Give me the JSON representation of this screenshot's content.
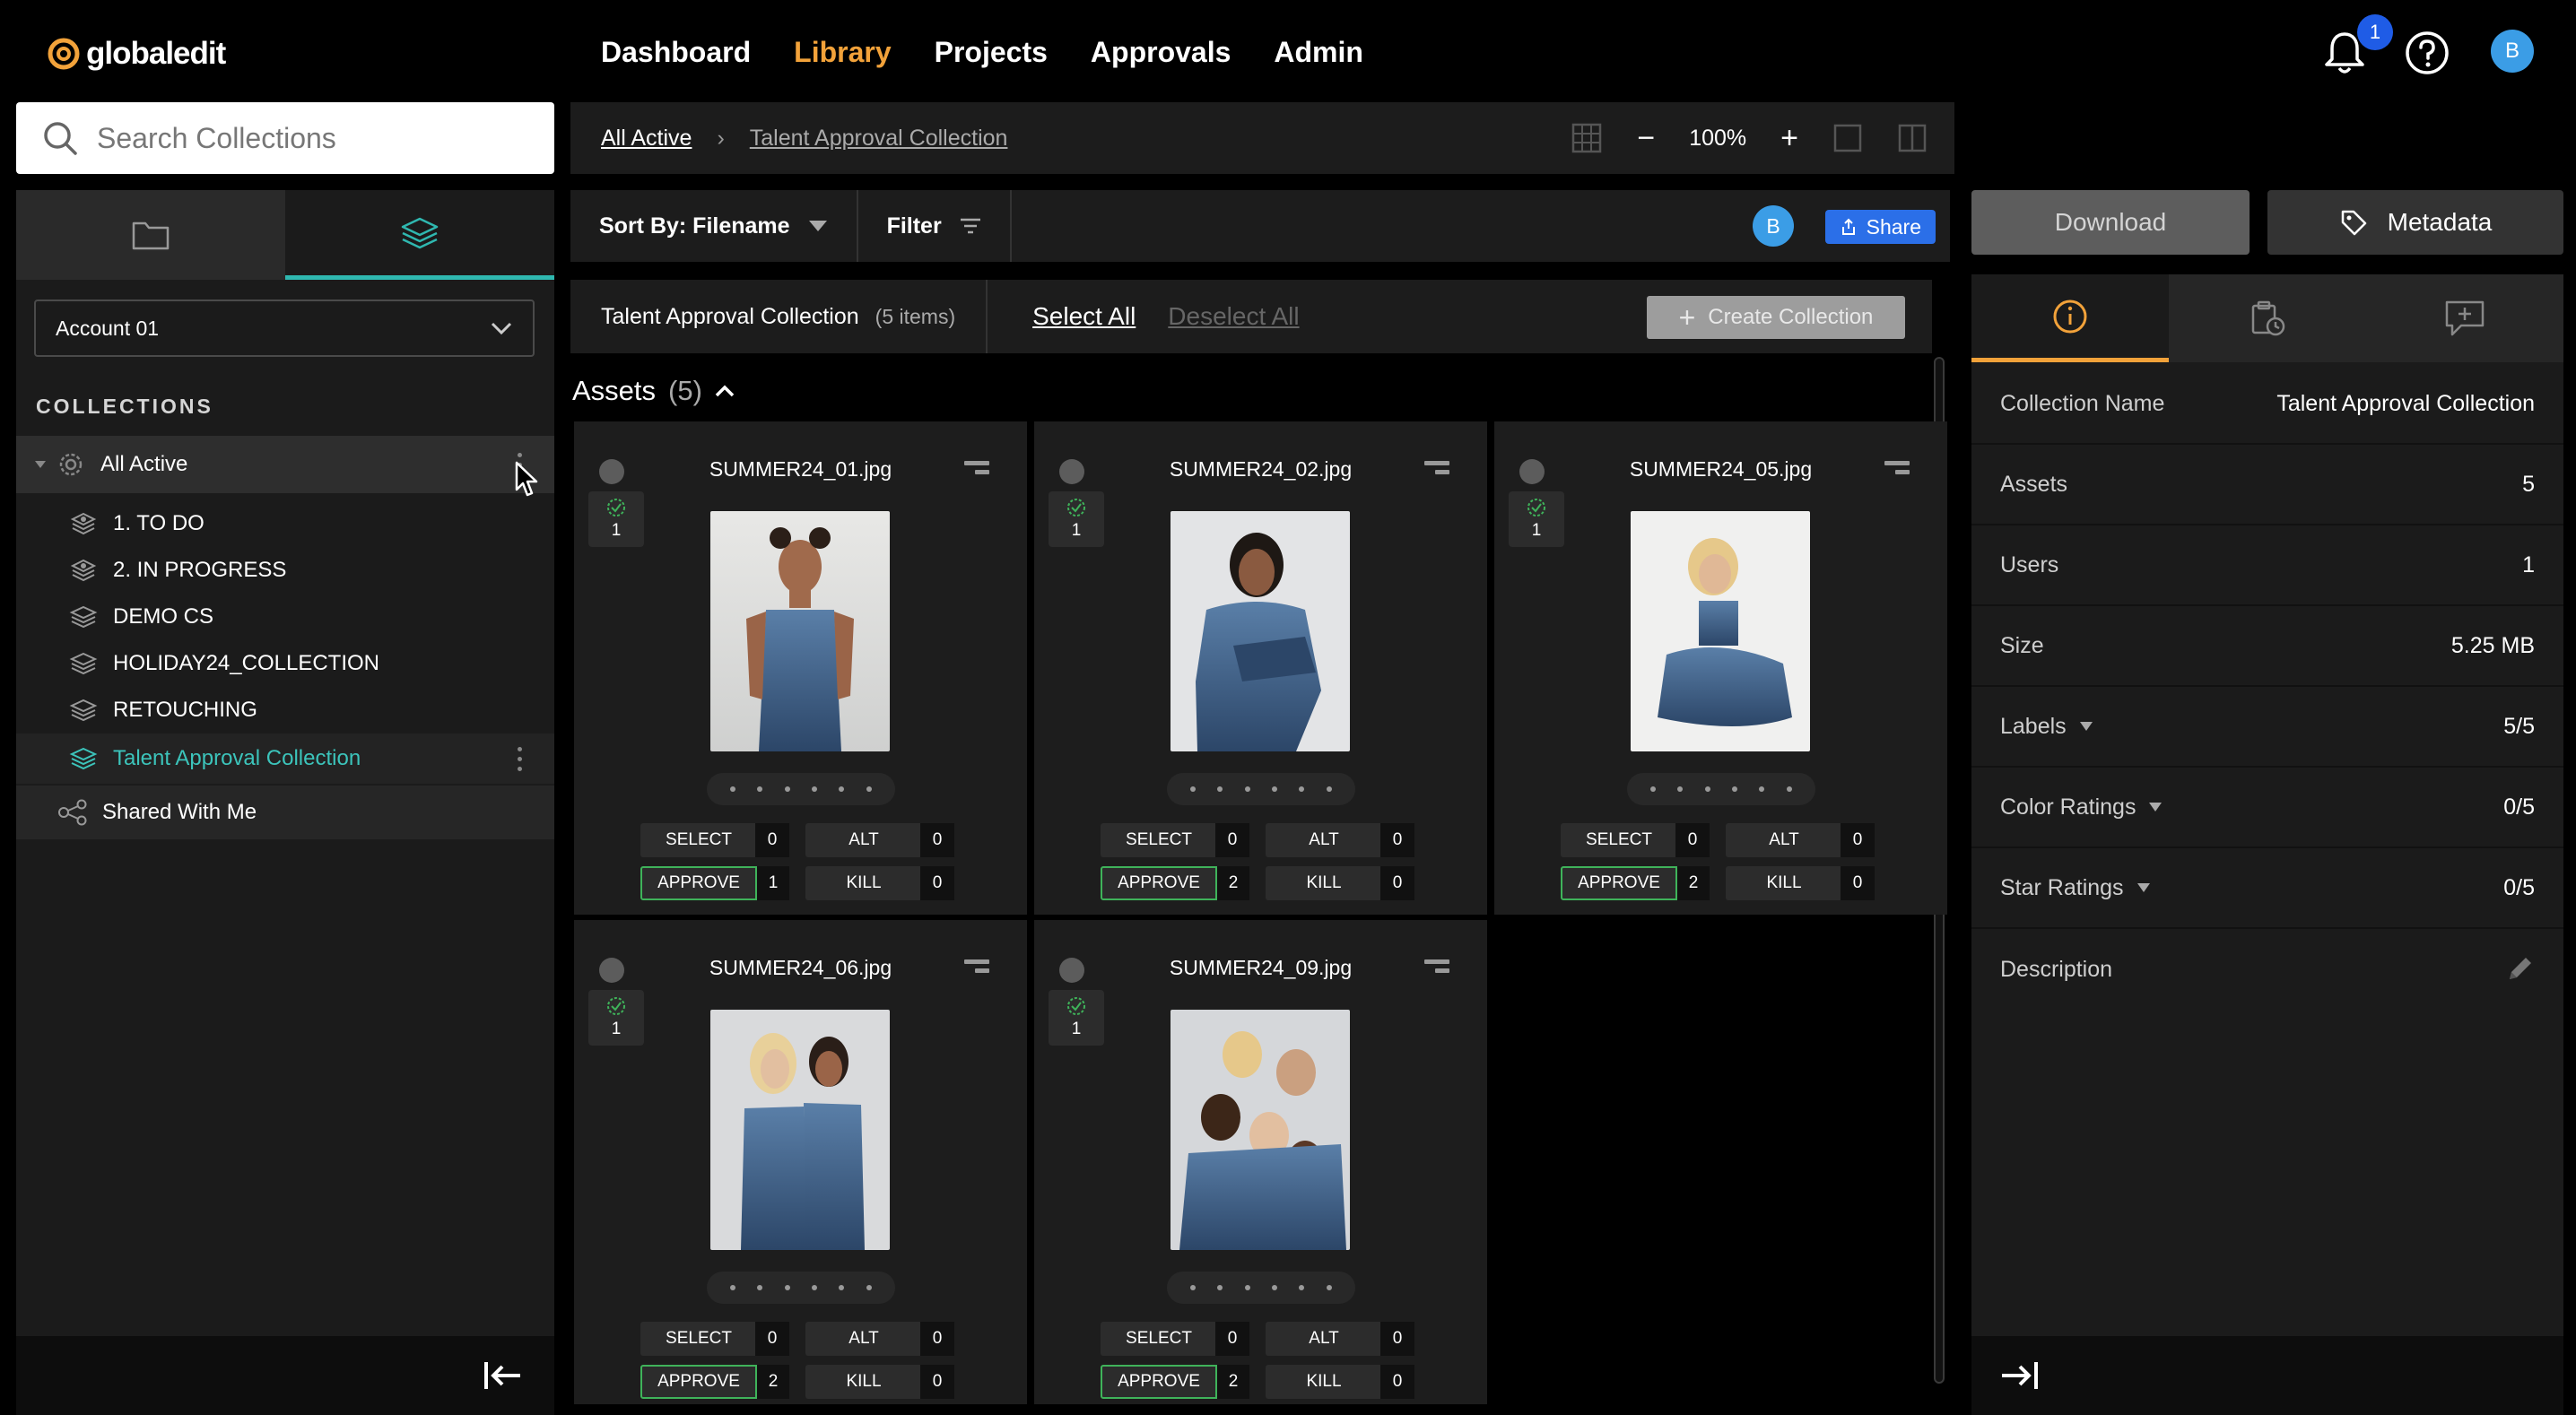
{
  "brand": {
    "name": "globaledit"
  },
  "nav": {
    "items": [
      "Dashboard",
      "Library",
      "Projects",
      "Approvals",
      "Admin"
    ],
    "active": "Library"
  },
  "header": {
    "notification_count": "1",
    "user_initial": "B"
  },
  "search": {
    "placeholder": "Search Collections"
  },
  "sidebar": {
    "account": "Account 01",
    "collections_header": "COLLECTIONS",
    "all_active": "All Active",
    "items": [
      "1. TO DO",
      "2. IN PROGRESS",
      "DEMO CS",
      "HOLIDAY24_COLLECTION",
      "RETOUCHING",
      "Talent Approval Collection"
    ],
    "shared": "Shared With Me"
  },
  "breadcrumb": {
    "root": "All Active",
    "current": "Talent Approval Collection"
  },
  "zoom": {
    "level": "100%"
  },
  "toolbar": {
    "sort_label": "Sort By: Filename",
    "filter_label": "Filter",
    "share_label": "Share",
    "user_initial": "B"
  },
  "collection_bar": {
    "title": "Talent Approval Collection",
    "count": "(5 items)",
    "select_all": "Select All",
    "deselect_all": "Deselect All",
    "create_label": "Create Collection"
  },
  "assets": {
    "heading": "Assets",
    "count": "(5)"
  },
  "cards": [
    {
      "filename": "SUMMER24_01.jpg",
      "version": "1",
      "select": "0",
      "alt": "0",
      "approve": "1",
      "kill": "0"
    },
    {
      "filename": "SUMMER24_02.jpg",
      "version": "1",
      "select": "0",
      "alt": "0",
      "approve": "2",
      "kill": "0"
    },
    {
      "filename": "SUMMER24_05.jpg",
      "version": "1",
      "select": "0",
      "alt": "0",
      "approve": "2",
      "kill": "0"
    },
    {
      "filename": "SUMMER24_06.jpg",
      "version": "1",
      "select": "0",
      "alt": "0",
      "approve": "2",
      "kill": "0"
    },
    {
      "filename": "SUMMER24_09.jpg",
      "version": "1",
      "select": "0",
      "alt": "0",
      "approve": "2",
      "kill": "0"
    }
  ],
  "labels": {
    "select": "SELECT",
    "alt": "ALT",
    "approve": "APPROVE",
    "kill": "KILL"
  },
  "actions": {
    "download": "Download",
    "metadata": "Metadata"
  },
  "details": {
    "collection_name_label": "Collection Name",
    "collection_name": "Talent Approval Collection",
    "assets_label": "Assets",
    "assets": "5",
    "users_label": "Users",
    "users": "1",
    "size_label": "Size",
    "size": "5.25 MB",
    "labels_label": "Labels",
    "labels": "5/5",
    "color_ratings_label": "Color Ratings",
    "color_ratings": "0/5",
    "star_ratings_label": "Star Ratings",
    "star_ratings": "0/5",
    "description_label": "Description"
  },
  "colors": {
    "accent_orange": "#f2a23a",
    "accent_teal": "#2fb8b0",
    "approve_green": "#3fb35a",
    "share_blue": "#2b6fe8"
  }
}
